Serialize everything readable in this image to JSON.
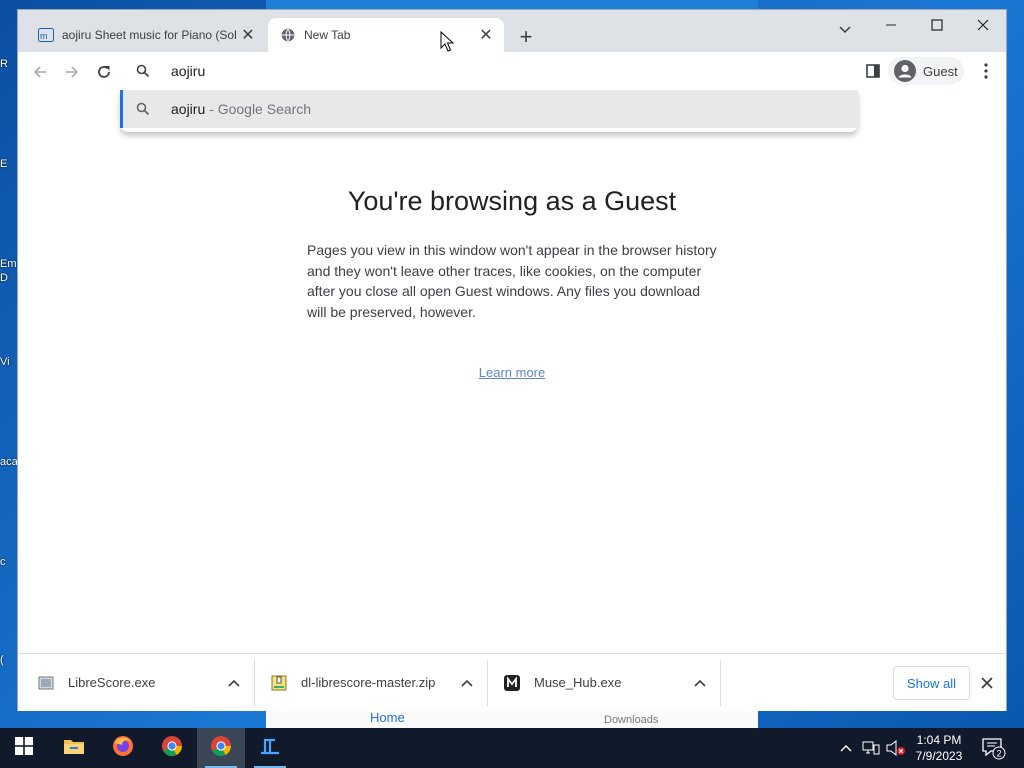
{
  "desktop": {
    "icon_labels": [
      "R",
      "E",
      "Em",
      "D",
      "Vi",
      "aca",
      "c",
      "("
    ]
  },
  "background_window": {
    "home_label": "Home",
    "downloads_label": "Downloads"
  },
  "browser": {
    "tabs": [
      {
        "title": "aojiru Sheet music for Piano (Sol",
        "favicon": "musescore-icon",
        "active": false
      },
      {
        "title": "New Tab",
        "favicon": "globe-icon",
        "active": true
      }
    ],
    "omnibox": {
      "value": "aojiru"
    },
    "suggestion": {
      "query": "aojiru",
      "separator": " - ",
      "source": "Google Search"
    },
    "profile": {
      "name": "Guest"
    }
  },
  "guest_page": {
    "headline": "You're browsing as a Guest",
    "body": "Pages you view in this window won't appear in the browser history and they won't leave other traces, like cookies, on the computer after you close all open Guest windows. Any files you download will be preserved, however.",
    "learn_more": "Learn more"
  },
  "download_shelf": {
    "items": [
      {
        "name": "LibreScore.exe",
        "icon": "installer-icon"
      },
      {
        "name": "dl-librescore-master.zip",
        "icon": "zip-archive-icon"
      },
      {
        "name": "Muse_Hub.exe",
        "icon": "musehub-icon"
      }
    ],
    "show_all": "Show all"
  },
  "taskbar": {
    "apps": [
      "start",
      "file-explorer",
      "firefox",
      "chrome",
      "chrome-active",
      "librescore"
    ],
    "clock_time": "1:04 PM",
    "clock_date": "7/9/2023",
    "notification_count": "2"
  },
  "colors": {
    "accent": "#1a73e8",
    "tabstrip": "#dee1e6",
    "taskbar": "#101a2b",
    "link": "#5f86c7"
  }
}
